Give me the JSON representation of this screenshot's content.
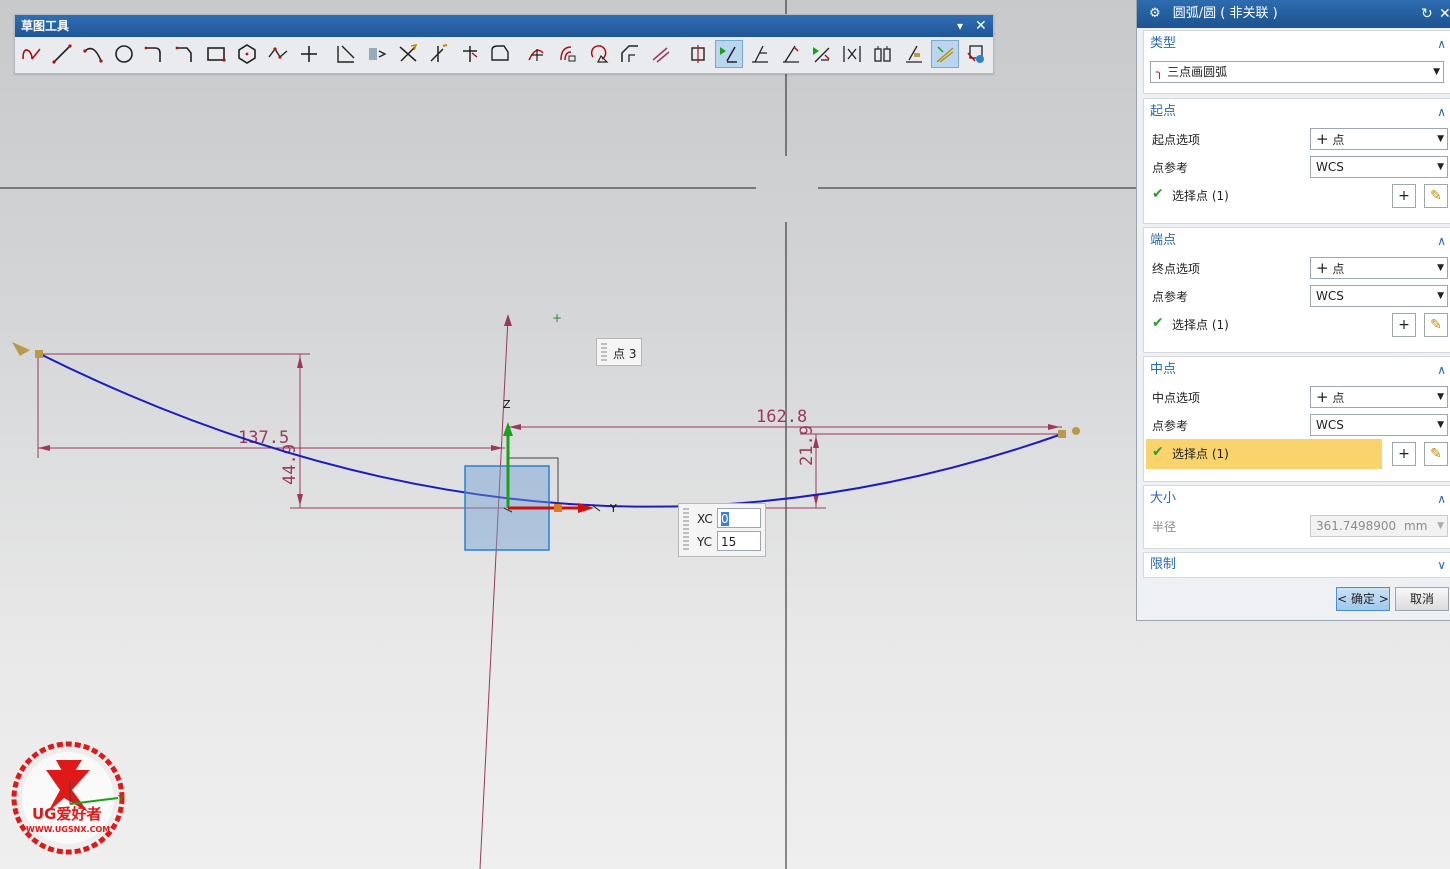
{
  "toolbar": {
    "title": "草图工具",
    "dropdown_glyph": "▾",
    "close_glyph": "✕",
    "tools": [
      {
        "name": "profile-tool-icon"
      },
      {
        "name": "line-tool-icon"
      },
      {
        "name": "arc-tool-icon"
      },
      {
        "name": "circle-tool-icon"
      },
      {
        "name": "fillet-tool-icon"
      },
      {
        "name": "chamfer-tool-icon"
      },
      {
        "name": "rectangle-tool-icon"
      },
      {
        "name": "polygon-tool-icon"
      },
      {
        "name": "studio-spline-tool-icon"
      },
      {
        "name": "point-tool-icon"
      },
      {
        "name": "offset-curve-tool-icon"
      },
      {
        "name": "pattern-curve-tool-icon"
      },
      {
        "name": "quick-trim-tool-icon"
      },
      {
        "name": "quick-extend-tool-icon"
      },
      {
        "name": "make-corner-tool-icon"
      },
      {
        "name": "derived-lines-tool-icon"
      },
      {
        "name": "move-curve-tool-icon"
      },
      {
        "name": "offset-move-curve-tool-icon"
      },
      {
        "name": "resize-curve-tool-icon"
      },
      {
        "name": "resize-chamfer-tool-icon"
      },
      {
        "name": "geometric-constraints-tool-icon"
      },
      {
        "name": "rapid-dimension-tool-icon"
      },
      {
        "name": "auto-constrain-tool-icon",
        "active": true
      },
      {
        "name": "show-constraints-tool-icon"
      },
      {
        "name": "convert-reference-tool-icon"
      },
      {
        "name": "alternate-solution-tool-icon"
      },
      {
        "name": "inferred-constraints-tool-icon"
      },
      {
        "name": "create-constraints-tool-icon"
      },
      {
        "name": "relations-browser-tool-icon"
      },
      {
        "name": "continuous-auto-dimension-tool-icon",
        "active": true
      },
      {
        "name": "sketch-evaluation-tool-icon"
      }
    ]
  },
  "dialog": {
    "title": "圆弧/圆 ( 非关联 )",
    "type_section": {
      "header": "类型",
      "value": "三点画圆弧"
    },
    "start_section": {
      "header": "起点",
      "option_label": "起点选项",
      "option_value": "点",
      "ref_label": "点参考",
      "ref_value": "WCS",
      "select_label": "选择点 (1)"
    },
    "end_section": {
      "header": "端点",
      "option_label": "终点选项",
      "option_value": "点",
      "ref_label": "点参考",
      "ref_value": "WCS",
      "select_label": "选择点 (1)"
    },
    "mid_section": {
      "header": "中点",
      "option_label": "中点选项",
      "option_value": "点",
      "ref_label": "点参考",
      "ref_value": "WCS",
      "select_label": "选择点 (1)"
    },
    "size_section": {
      "header": "大小",
      "radius_label": "半径",
      "radius_value": "361.7498900",
      "radius_unit": "mm"
    },
    "limits_section": {
      "header": "限制"
    },
    "ok_label": "< 确定 >",
    "cancel_label": "取消",
    "colors": {
      "title_bar": "#1f5596",
      "section_header": "#2b69ad",
      "highlight": "#f9d46d"
    }
  },
  "viewport": {
    "point_label": "点 3",
    "dim_left_horizontal": "137.5",
    "dim_left_vertical": "44.9",
    "dim_right_horizontal": "162.8",
    "dim_right_vertical": "21.9",
    "axis_z": "Z",
    "axis_y": "Y",
    "xc_label": "XC",
    "xc_value": "0",
    "yc_label": "YC",
    "yc_value": "15",
    "colors": {
      "arc": "#1d1dbd",
      "dimension": "#9a3a5a",
      "axis_x": "#d01010",
      "axis_y": "#1aa01a"
    }
  },
  "watermark": {
    "text": "UG爱好者",
    "url_text": "WWW.UGSNX.COM",
    "axis_y": "Y",
    "color": "#e01818"
  }
}
